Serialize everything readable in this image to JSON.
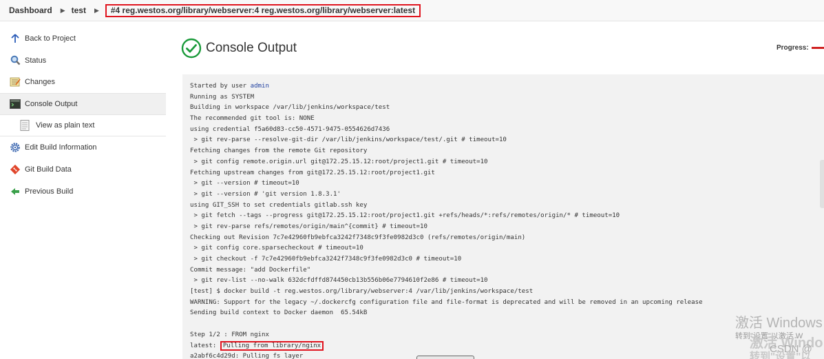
{
  "breadcrumb": {
    "items": [
      "Dashboard",
      "test"
    ],
    "current": "#4 reg.westos.org/library/webserver:4 reg.westos.org/library/webserver:latest"
  },
  "sidebar": {
    "items": [
      {
        "label": "Back to Project",
        "icon": "arrow-up-icon"
      },
      {
        "label": "Status",
        "icon": "magnifier-icon"
      },
      {
        "label": "Changes",
        "icon": "notepad-icon"
      },
      {
        "label": "Console Output",
        "icon": "terminal-icon"
      },
      {
        "label": "View as plain text",
        "icon": "document-icon"
      },
      {
        "label": "Edit Build Information",
        "icon": "gear-icon"
      },
      {
        "label": "Git Build Data",
        "icon": "git-icon"
      },
      {
        "label": "Previous Build",
        "icon": "arrow-left-icon"
      }
    ]
  },
  "header": {
    "title": "Console Output",
    "progress_label": "Progress:"
  },
  "console": {
    "started_prefix": "Started by user ",
    "started_user": "admin",
    "lines": [
      "Running as SYSTEM",
      "Building in workspace /var/lib/jenkins/workspace/test",
      "The recommended git tool is: NONE",
      "using credential f5a60d83-cc50-4571-9475-0554626d7436",
      " > git rev-parse --resolve-git-dir /var/lib/jenkins/workspace/test/.git # timeout=10",
      "Fetching changes from the remote Git repository",
      " > git config remote.origin.url git@172.25.15.12:root/project1.git # timeout=10",
      "Fetching upstream changes from git@172.25.15.12:root/project1.git",
      " > git --version # timeout=10",
      " > git --version # 'git version 1.8.3.1'",
      "using GIT_SSH to set credentials gitlab.ssh key",
      " > git fetch --tags --progress git@172.25.15.12:root/project1.git +refs/heads/*:refs/remotes/origin/* # timeout=10",
      " > git rev-parse refs/remotes/origin/main^{commit} # timeout=10",
      "Checking out Revision 7c7e42960fb9ebfca3242f7348c9f3fe0982d3c0 (refs/remotes/origin/main)",
      " > git config core.sparsecheckout # timeout=10",
      " > git checkout -f 7c7e42960fb9ebfca3242f7348c9f3fe0982d3c0 # timeout=10",
      "Commit message: \"add Dockerfile\"",
      " > git rev-list --no-walk 632dcfdffd874450cb13b556b06e7794610f2e86 # timeout=10",
      "[test] $ docker build -t reg.westos.org/library/webserver:4 /var/lib/jenkins/workspace/test",
      "WARNING: Support for the legacy ~/.dockercfg configuration file and file-format is deprecated and will be removed in an upcoming release",
      "Sending build context to Docker daemon  65.54kB"
    ],
    "step_line": "Step 1/2 : FROM nginx",
    "pull_prefix": "latest: ",
    "pull_highlight": "Pulling from library/nginx",
    "last_line": "a2abf6c4d29d: Pulling fs layer"
  },
  "watermark": {
    "activate": "激活 Windows",
    "goto": "转到\"设置\"以激活 W",
    "activate2": "激活 Windo",
    "csdn": "CSDN @",
    "goto2": "转到\"设置\"以"
  },
  "colors": {
    "highlight_border": "#e0141e",
    "link": "#2040a0",
    "success_green": "#1a9a3a"
  }
}
